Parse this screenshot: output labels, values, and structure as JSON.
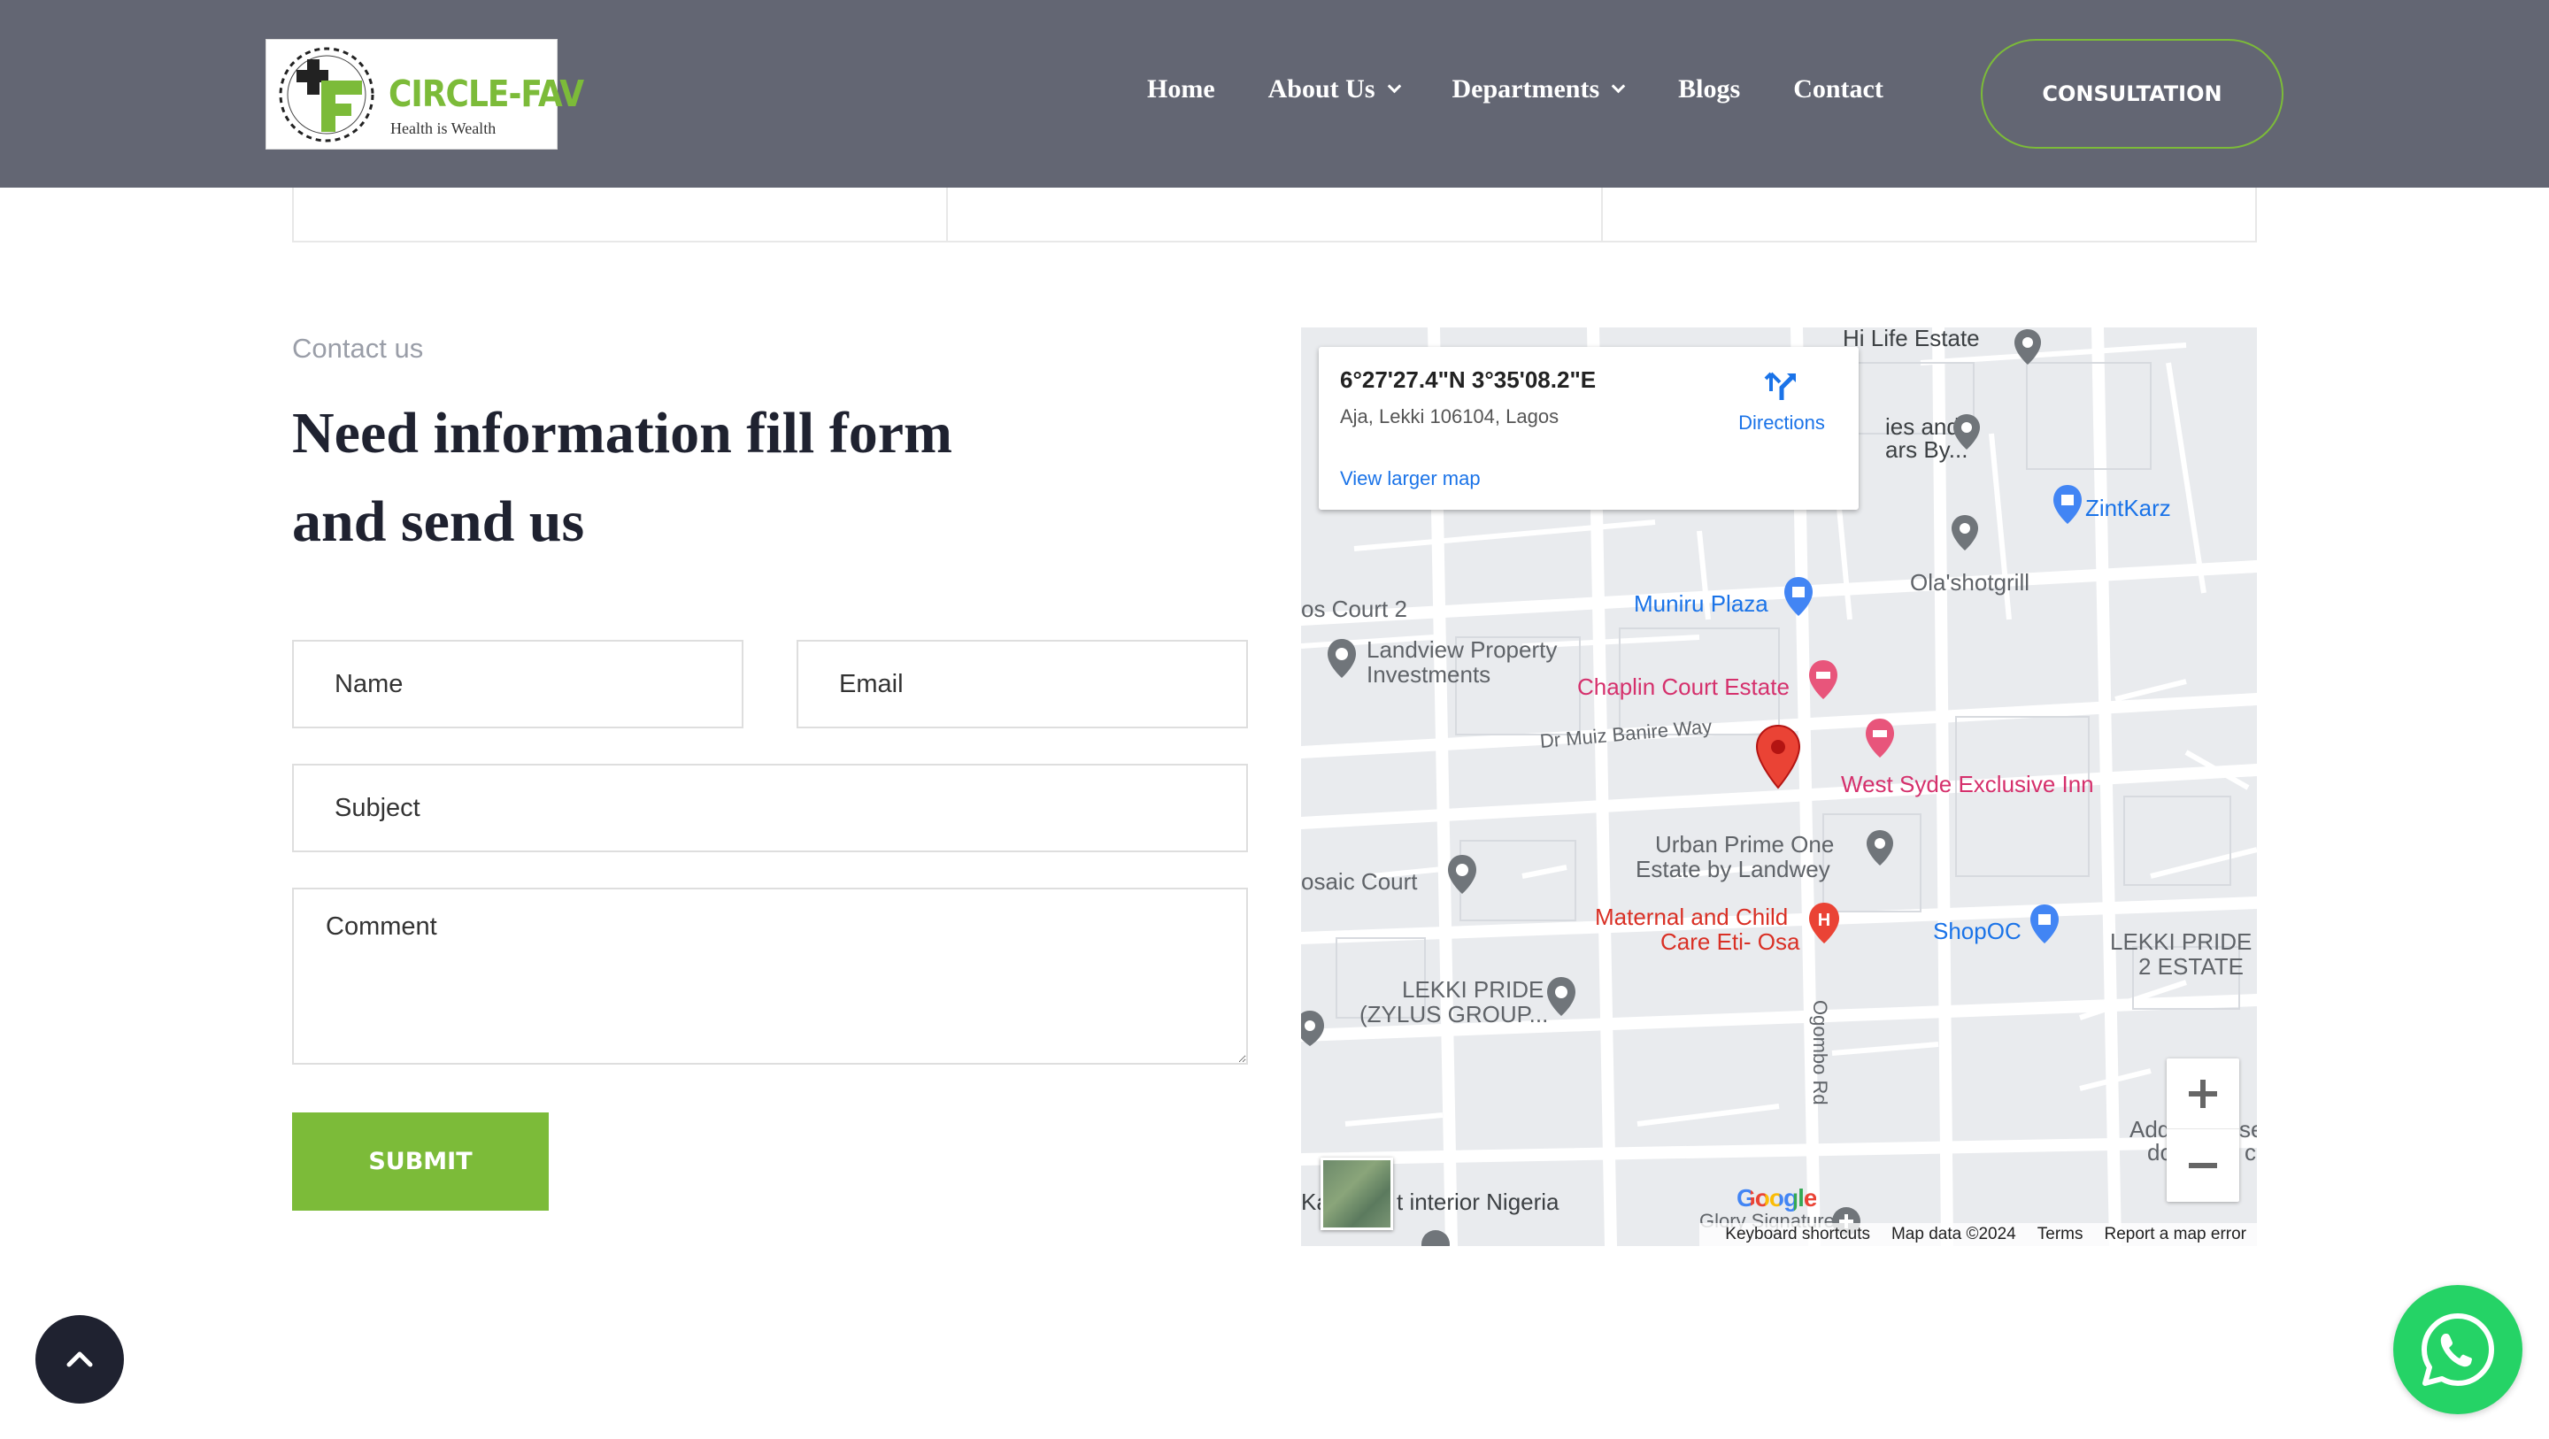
{
  "header": {
    "logo": {
      "name": "CIRCLE-FAV",
      "tagline": "Health is Wealth"
    },
    "nav": [
      {
        "label": "Home",
        "has_dropdown": false
      },
      {
        "label": "About Us",
        "has_dropdown": true
      },
      {
        "label": "Departments",
        "has_dropdown": true
      },
      {
        "label": "Blogs",
        "has_dropdown": false
      },
      {
        "label": "Contact",
        "has_dropdown": false
      }
    ],
    "cta_label": "CONSULTATION",
    "bg_color": "#636673",
    "accent_color": "#7cbb39"
  },
  "contact": {
    "eyebrow": "Contact us",
    "heading_line1": "Need information fill form",
    "heading_line2": "and send us",
    "form": {
      "name_placeholder": "Name",
      "email_placeholder": "Email",
      "subject_placeholder": "Subject",
      "comment_placeholder": "Comment",
      "submit_label": "SUBMIT"
    }
  },
  "map": {
    "info": {
      "coords": "6°27'27.4\"N 3°35'08.2\"E",
      "address": "Aja, Lekki 106104, Lagos",
      "directions_label": "Directions",
      "larger_map_label": "View larger map"
    },
    "places": {
      "hi_life": "Hi Life Estate",
      "ies_and": "ies and",
      "ars_by": "ars By...",
      "zintkarz": "ZintKarz",
      "olashotgrill": "Ola'shotgrill",
      "muniru": "Muniru Plaza",
      "os_court": "os Court 2",
      "landview": "Landview Property",
      "investments": "Investments",
      "chaplin": "Chaplin Court Estate",
      "dr_muiz": "Dr Muiz Banire Way",
      "west_syde": "West Syde Exclusive Inn",
      "urban_prime": "Urban Prime One",
      "estate_landwey": "Estate by Landwey",
      "osaic": "osaic Court",
      "maternal": "Maternal and Child",
      "care_eti": "Care Eti- Osa",
      "shopoc": "ShopOC",
      "lekki_pride_right": "LEKKI PRIDE",
      "estate2": "2 ESTATE",
      "lekki_pride_left": "LEKKI PRIDE",
      "zylus": "(ZYLUS GROUP...",
      "ogombo": "Ogombo Rd",
      "add": "Add",
      "se": "se",
      "do": "do",
      "c": "c",
      "ka": "Ka",
      "interior": "t interior Nigeria",
      "glory": "Glory Signature"
    },
    "google": "Google",
    "attribution": [
      "Keyboard shortcuts",
      "Map data ©2024",
      "Terms",
      "Report a map error"
    ]
  },
  "floating": {
    "scroll_top_icon": "chevron-up-icon",
    "whatsapp_icon": "whatsapp-icon"
  }
}
